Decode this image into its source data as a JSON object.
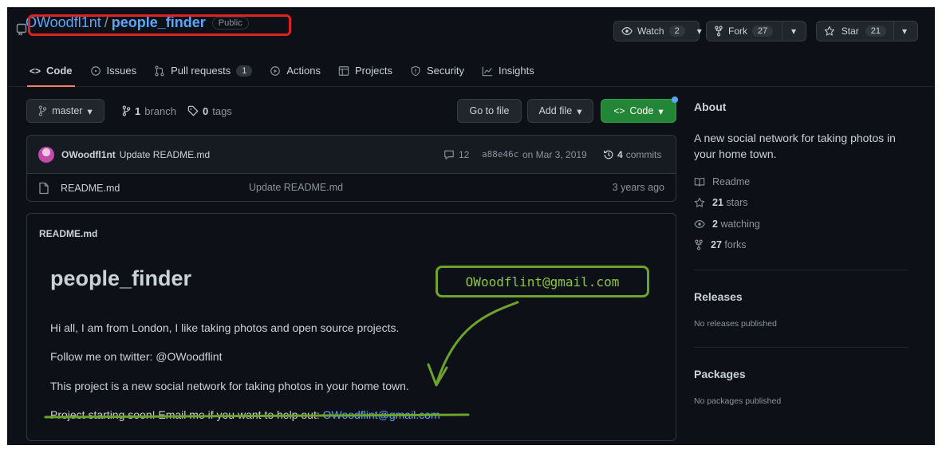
{
  "repo": {
    "owner": "OWoodfl1nt",
    "separator": "/",
    "name": "people_finder",
    "visibility": "Public"
  },
  "header": {
    "watch_label": "Watch",
    "watch_count": "2",
    "fork_label": "Fork",
    "fork_count": "27",
    "star_label": "Star",
    "star_count": "21"
  },
  "tabs": [
    {
      "label": "Code",
      "icon": "code-icon"
    },
    {
      "label": "Issues",
      "icon": "issue-icon"
    },
    {
      "label": "Pull requests",
      "icon": "pull-request-icon",
      "count": "1"
    },
    {
      "label": "Actions",
      "icon": "play-icon"
    },
    {
      "label": "Projects",
      "icon": "table-icon"
    },
    {
      "label": "Security",
      "icon": "shield-icon"
    },
    {
      "label": "Insights",
      "icon": "graph-icon"
    }
  ],
  "toolbar": {
    "branch": "master",
    "branch_count": "1",
    "branch_word": "branch",
    "tag_count": "0",
    "tag_word": "tags",
    "go_to_file": "Go to file",
    "add_file": "Add file",
    "code": "Code"
  },
  "commit": {
    "author": "OWoodfl1nt",
    "message": "Update README.md",
    "comments": "12",
    "sha": "a88e46c",
    "date": "on Mar 3, 2019",
    "commit_count": "4",
    "commit_word": "commits"
  },
  "files": [
    {
      "name": "README.md",
      "message": "Update README.md",
      "age": "3 years ago"
    }
  ],
  "readme": {
    "header": "README.md",
    "title": "people_finder",
    "p1": "Hi all, I am from London, I like taking photos and open source projects.",
    "p2": "Follow me on twitter: @OWoodflint",
    "p3": "This project is a new social network for taking photos in your home town.",
    "p4_text": "Project starting soon! Email me if you want to help out: ",
    "p4_link": "OWoodflint@gmail.com"
  },
  "annotation": {
    "email": "OWoodflint@gmail.com"
  },
  "about": {
    "heading": "About",
    "description_line1": "A new social network for taking photos in",
    "description_line2": "your home town.",
    "readme_label": "Readme",
    "stars_count": "21",
    "stars_word": "stars",
    "watching_count": "2",
    "watching_word": "watching",
    "forks_count": "27",
    "forks_word": "forks"
  },
  "releases": {
    "heading": "Releases",
    "empty": "No releases published"
  },
  "packages": {
    "heading": "Packages",
    "empty": "No packages published"
  },
  "colors": {
    "background": "#0d1117",
    "link": "#58a6ff",
    "green_button": "#238636",
    "highlight_red": "#dd2222",
    "annotation_green": "#6ea32a"
  }
}
